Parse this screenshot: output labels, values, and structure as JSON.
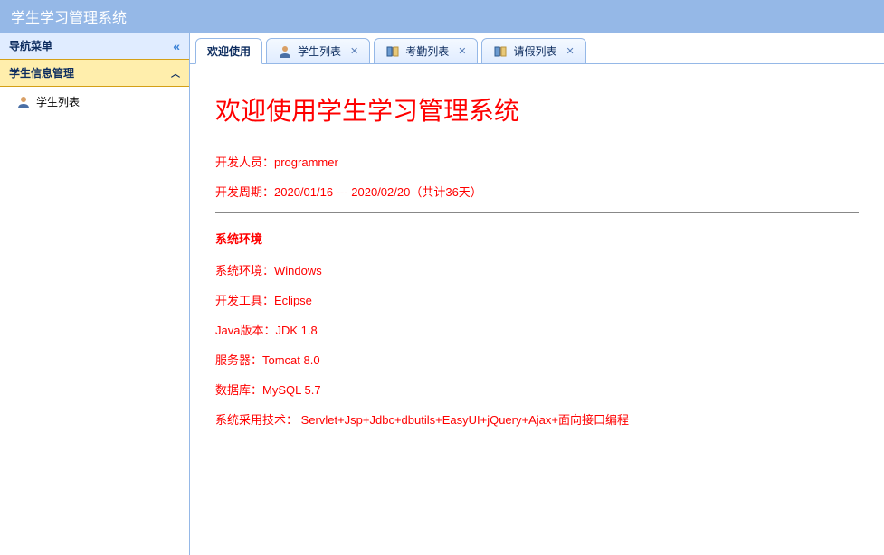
{
  "header": {
    "title": "学生学习管理系统"
  },
  "sidebar": {
    "title": "导航菜单",
    "accordion": {
      "title": "学生信息管理"
    },
    "items": [
      {
        "label": "学生列表"
      }
    ]
  },
  "tabs": [
    {
      "label": "欢迎使用",
      "closable": false,
      "active": true
    },
    {
      "label": "学生列表",
      "closable": true,
      "active": false
    },
    {
      "label": "考勤列表",
      "closable": true,
      "active": false
    },
    {
      "label": "请假列表",
      "closable": true,
      "active": false
    }
  ],
  "welcome": {
    "heading": "欢迎使用学生学习管理系统",
    "developer": "开发人员：programmer",
    "period": "开发周期：2020/01/16 --- 2020/02/20（共计36天）",
    "env_title": "系统环境",
    "lines": [
      "系统环境：Windows",
      "开发工具：Eclipse",
      "Java版本：JDK 1.8",
      "服务器：Tomcat 8.0",
      "数据库：MySQL 5.7",
      "系统采用技术： Servlet+Jsp+Jdbc+dbutils+EasyUI+jQuery+Ajax+面向接口编程"
    ]
  }
}
